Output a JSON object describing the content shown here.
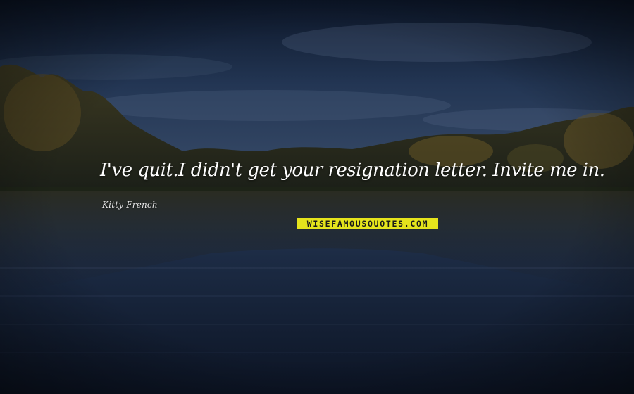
{
  "quote": {
    "text": "I've quit.I didn't get your resignation letter. Invite me in.",
    "author": "Kitty French"
  },
  "watermark": {
    "text": "WISEFAMOUSQUOTES.COM",
    "background_color": "#e5e41c"
  },
  "colors": {
    "text": "#ffffff",
    "sky_top": "#0e1a2e",
    "sky_mid": "#2a3d5c",
    "water": "#152238"
  }
}
